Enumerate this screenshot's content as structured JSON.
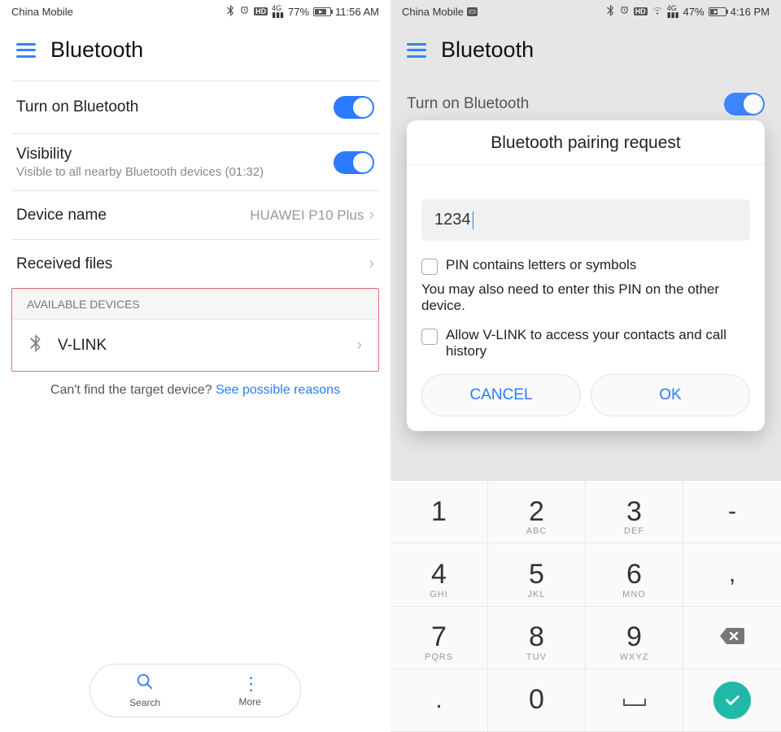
{
  "left": {
    "status": {
      "carrier": "China Mobile",
      "battery_pct": "77%",
      "time": "11:56 AM"
    },
    "header_title": "Bluetooth",
    "rows": {
      "turn_on": "Turn on Bluetooth",
      "visibility": "Visibility",
      "visibility_sub": "Visible to all nearby Bluetooth devices (01:32)",
      "device_name": "Device name",
      "device_name_value": "HUAWEI P10 Plus",
      "received_files": "Received files"
    },
    "section": "AVAILABLE DEVICES",
    "device": "V-LINK",
    "hint_text": "Can't find the target device? ",
    "hint_link": "See possible reasons",
    "pill": {
      "search": "Search",
      "more": "More"
    }
  },
  "right": {
    "status": {
      "carrier": "China Mobile",
      "battery_pct": "47%",
      "time": "4:16 PM"
    },
    "header_title": "Bluetooth",
    "cut_row": "Turn on Bluetooth",
    "dialog": {
      "title": "Bluetooth pairing request",
      "pin": "1234",
      "chk1": "PIN contains letters or symbols",
      "note": "You may also need to enter this PIN on the other device.",
      "chk2": "Allow V-LINK to access your contacts and call history",
      "cancel": "CANCEL",
      "ok": "OK"
    },
    "keypad": {
      "k1": "1",
      "k2": "2",
      "k3": "3",
      "k4": "-",
      "k5": "4",
      "k6": "5",
      "k7": "6",
      "k8": ",",
      "k9": "7",
      "k10": "8",
      "k11": "9",
      "k13": ".",
      "k14": "0"
    }
  }
}
